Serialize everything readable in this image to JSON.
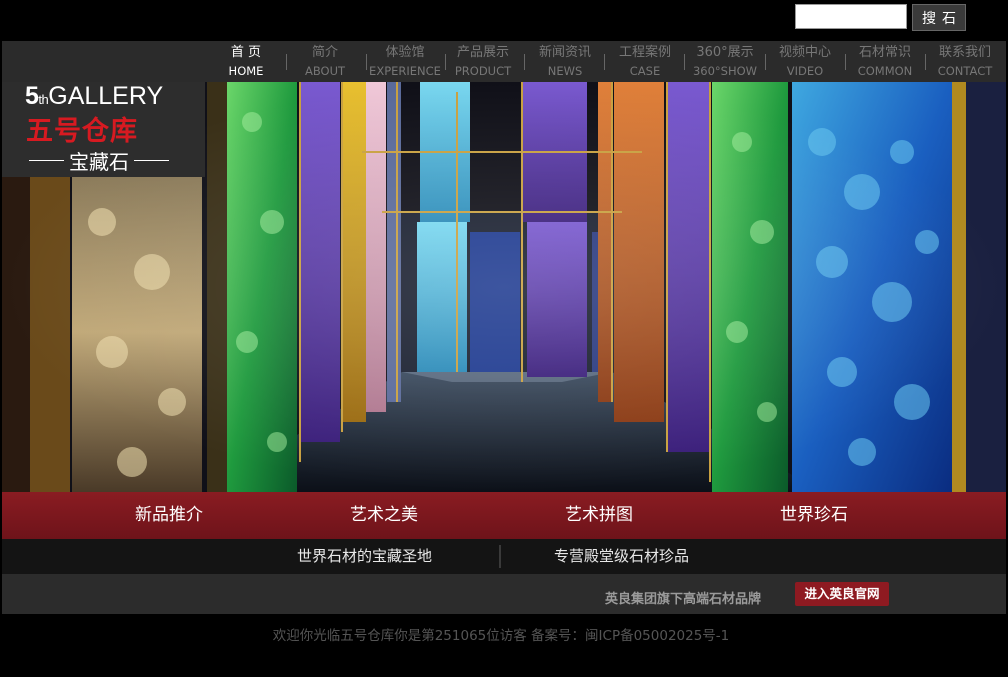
{
  "search": {
    "placeholder": "",
    "button_label": "搜石"
  },
  "nav": {
    "items": [
      {
        "zh": "首 页",
        "en": "HOME",
        "active": true
      },
      {
        "zh": "简介",
        "en": "ABOUT"
      },
      {
        "zh": "体验馆",
        "en": "EXPERIENCE"
      },
      {
        "zh": "产品展示",
        "en": "PRODUCT"
      },
      {
        "zh": "新闻资讯",
        "en": "NEWS"
      },
      {
        "zh": "工程案例",
        "en": "CASE"
      },
      {
        "zh": "360°展示",
        "en": "360°SHOW"
      },
      {
        "zh": "视频中心",
        "en": "VIDEO"
      },
      {
        "zh": "石材常识",
        "en": "COMMON"
      },
      {
        "zh": "联系我们",
        "en": "CONTACT"
      }
    ]
  },
  "logo": {
    "num": "5",
    "suffix": "th",
    "gallery": "GALLERY",
    "name_zh": "五号仓库",
    "tagline": "宝藏石"
  },
  "categories": [
    "新品推介",
    "艺术之美",
    "艺术拼图",
    "世界珍石"
  ],
  "slogans": [
    "世界石材的宝藏圣地",
    "专营殿堂级石材珍品"
  ],
  "brand": {
    "text": "英良集团旗下高端石材品牌",
    "button_label": "进入英良官网"
  },
  "footer": {
    "text": "欢迎你光临五号仓库你是第251065位访客 备案号：闽ICP备05002025号-1"
  },
  "colors": {
    "accent_red": "#8a1c22",
    "logo_red": "#d71a21",
    "nav_bg": "#2b2b2b"
  }
}
